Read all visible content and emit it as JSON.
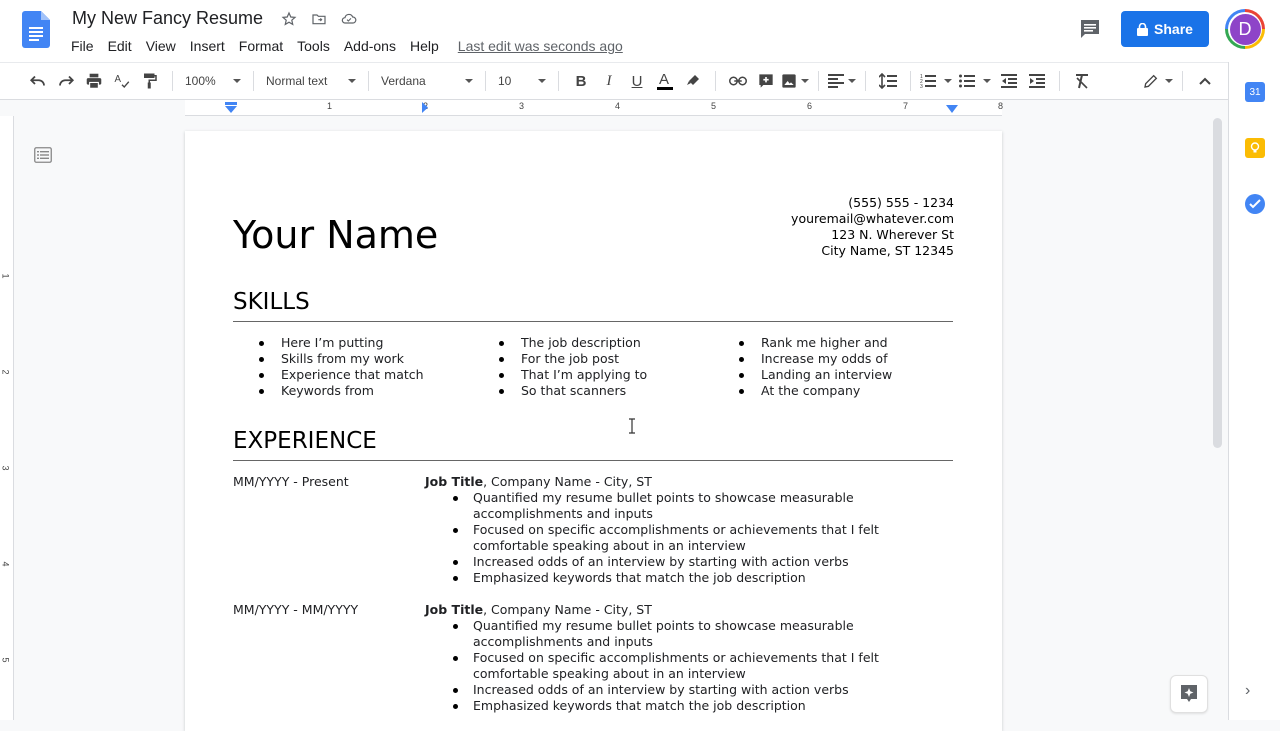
{
  "app": {
    "doc_title": "My New Fancy Resume",
    "menus": [
      "File",
      "Edit",
      "View",
      "Insert",
      "Format",
      "Tools",
      "Add-ons",
      "Help"
    ],
    "last_edit": "Last edit was seconds ago",
    "share_label": "Share",
    "avatar_initial": "D",
    "accent_color": "#1a73e8"
  },
  "toolbar": {
    "zoom": "100%",
    "style": "Normal text",
    "font": "Verdana",
    "font_size": "10"
  },
  "ruler": {
    "marks": [
      "1",
      "2",
      "3",
      "4",
      "5",
      "6",
      "7",
      "8"
    ]
  },
  "vruler": {
    "marks": [
      "1",
      "2",
      "3",
      "4",
      "5"
    ]
  },
  "document": {
    "name": "Your Name",
    "contact": [
      "(555) 555 - 1234",
      "youremail@whatever.com",
      "123 N. Wherever St",
      "City Name, ST 12345"
    ],
    "skills_heading": "SKILLS",
    "skills_columns": [
      [
        "Here I’m putting",
        "Skills from my work",
        "Experience that match",
        "Keywords from"
      ],
      [
        "The job description",
        "For the job post",
        "That I’m applying to",
        "So that scanners"
      ],
      [
        "Rank me higher and",
        "Increase my odds of",
        "Landing an interview",
        "At the company"
      ]
    ],
    "experience_heading": "EXPERIENCE",
    "jobs": [
      {
        "dates": "MM/YYYY - Present",
        "title": "Job Title",
        "company": ", Company Name - City, ST",
        "bullets": [
          "Quantified my resume bullet points to showcase measurable accomplishments and inputs",
          "Focused on specific accomplishments or achievements that I felt comfortable speaking about in an interview",
          "Increased odds of an interview by starting with action verbs",
          "Emphasized keywords that match the job description"
        ]
      },
      {
        "dates": "MM/YYYY - MM/YYYY",
        "title": "Job Title",
        "company": ", Company Name - City, ST",
        "bullets": [
          "Quantified my resume bullet points to showcase measurable accomplishments and inputs",
          "Focused on specific accomplishments or achievements that I felt comfortable speaking about in an interview",
          "Increased odds of an interview by starting with action verbs",
          "Emphasized keywords that match the job description"
        ]
      }
    ]
  }
}
